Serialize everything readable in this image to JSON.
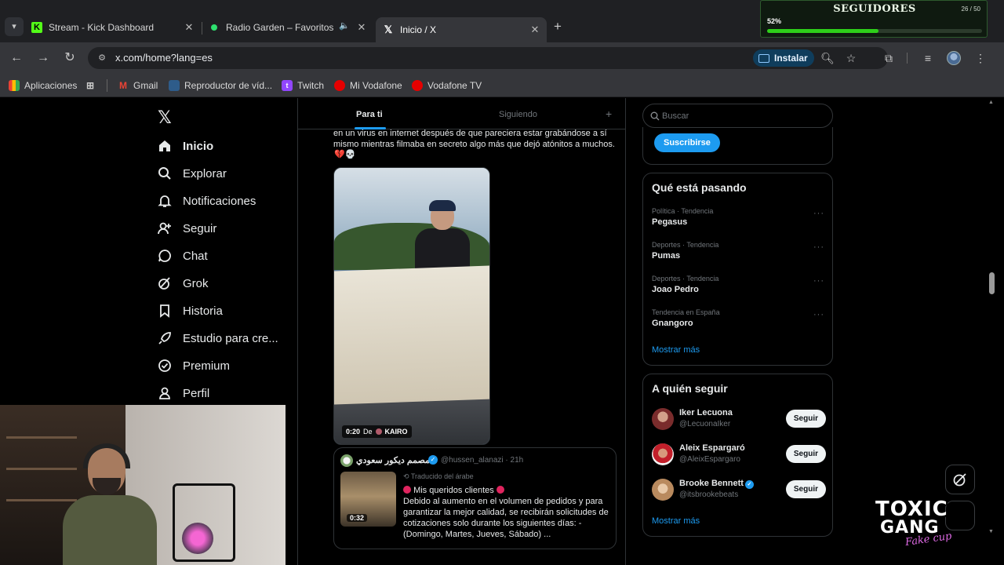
{
  "tabs": [
    {
      "title": "Stream - Kick Dashboard",
      "favicon": "kick-icon"
    },
    {
      "title": "Radio Garden – Favoritos",
      "favicon": "radio-garden-icon",
      "audio": "speaker-icon"
    },
    {
      "title": "Inicio / X",
      "favicon": "x-icon",
      "active": true
    }
  ],
  "toolbar": {
    "url": "x.com/home?lang=es",
    "install_label": "Instalar"
  },
  "bookmarks": [
    {
      "label": "Aplicaciones",
      "icon": "apps-grid-icon"
    },
    {
      "label": "Gmail",
      "icon": "gmail-icon"
    },
    {
      "label": "Reproductor de víd...",
      "icon": "video-player-icon"
    },
    {
      "label": "Twitch",
      "icon": "twitch-icon"
    },
    {
      "label": "Mi Vodafone",
      "icon": "vodafone-icon"
    },
    {
      "label": "Vodafone TV",
      "icon": "vodafone-icon"
    }
  ],
  "nav": [
    {
      "label": "Inicio",
      "icon": "home-icon"
    },
    {
      "label": "Explorar",
      "icon": "search-icon"
    },
    {
      "label": "Notificaciones",
      "icon": "bell-icon"
    },
    {
      "label": "Seguir",
      "icon": "follow-icon"
    },
    {
      "label": "Chat",
      "icon": "chat-icon"
    },
    {
      "label": "Grok",
      "icon": "grok-icon"
    },
    {
      "label": "Historia",
      "icon": "bookmark-icon"
    },
    {
      "label": "Estudio para cre...",
      "icon": "rocket-icon"
    },
    {
      "label": "Premium",
      "icon": "premium-icon"
    },
    {
      "label": "Perfil",
      "icon": "profile-icon"
    }
  ],
  "feed": {
    "tab_for_you": "Para ti",
    "tab_following": "Siguiendo",
    "tweet_text": "en un virus en internet después de que pareciera estar grabándose a sí mismo mientras filmaba en secreto algo más que dejó atónitos a muchos.",
    "tweet_emojis": "💔💀",
    "video_time": "0:20",
    "video_from": "De",
    "video_source": "KAIRO",
    "quote": {
      "name": "مصمم ديكور سعودي",
      "handle": "@hussen_alanazi · 21h",
      "translated": "Traducido del árabe",
      "line1": "Mis queridos clientes",
      "body": "Debido al aumento en el volumen de pedidos y para garantizar la mejor calidad, se recibirán solicitudes de cotizaciones solo durante los siguientes días: - (Domingo, Martes, Jueves, Sábado)  ...",
      "thumb_time": "0:32"
    }
  },
  "right": {
    "search_placeholder": "Buscar",
    "subscribe_label": "Suscribirse",
    "trends_title": "Qué está pasando",
    "trends": [
      {
        "meta": "Política · Tendencia",
        "name": "Pegasus"
      },
      {
        "meta": "Deportes · Tendencia",
        "name": "Pumas"
      },
      {
        "meta": "Deportes · Tendencia",
        "name": "Joao Pedro"
      },
      {
        "meta": "Tendencia en España",
        "name": "Gnangoro"
      }
    ],
    "show_more": "Mostrar más",
    "follow_title": "A quién seguir",
    "follow": [
      {
        "name": "Iker Lecuona",
        "handle": "@LecuonaIker",
        "button": "Seguir",
        "verified": false
      },
      {
        "name": "Aleix Espargaró",
        "handle": "@AleixEspargaro",
        "button": "Seguir",
        "verified": false
      },
      {
        "name": "Brooke Bennett",
        "handle": "@itsbrookebeats",
        "button": "Seguir",
        "verified": true
      }
    ],
    "follow_show_more": "Mostrar más"
  },
  "overlay": {
    "followers_title": "SEGUIDORES",
    "followers_count": "26 / 50",
    "followers_pct": "52%",
    "followers_fraction": 0.52,
    "logo_line1": "TOXIC",
    "logo_line2": "GANG"
  },
  "colors": {
    "accent": "#1d9bf0",
    "background": "#000000",
    "progress": "#2ed01a"
  }
}
